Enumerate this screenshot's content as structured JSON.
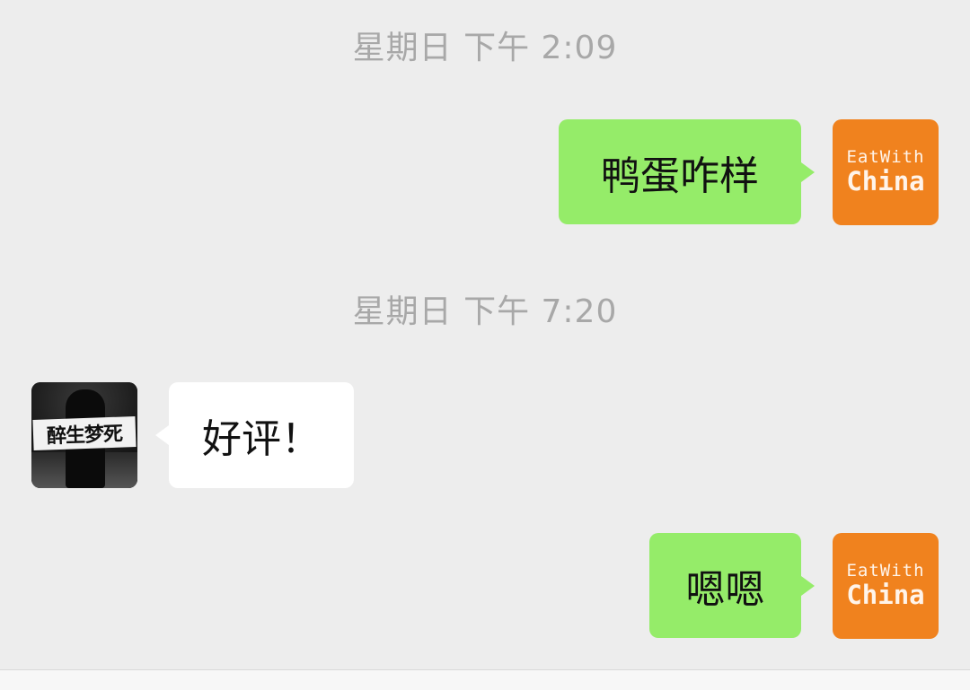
{
  "timestamps": [
    "星期日 下午 2:09",
    "星期日 下午 7:20"
  ],
  "brand_avatar": {
    "top_text": "EatWith",
    "bottom_text": "China",
    "color": "#f0821e"
  },
  "friend_avatar": {
    "banner_text": "醉生梦死"
  },
  "messages": [
    {
      "sender": "self",
      "text": "鸭蛋咋样"
    },
    {
      "sender": "friend",
      "text": "好评！"
    },
    {
      "sender": "self",
      "text": "嗯嗯"
    }
  ],
  "colors": {
    "self_bubble": "#95ec69",
    "friend_bubble": "#ffffff",
    "background": "#ededed",
    "timestamp": "#a8a8a8"
  }
}
